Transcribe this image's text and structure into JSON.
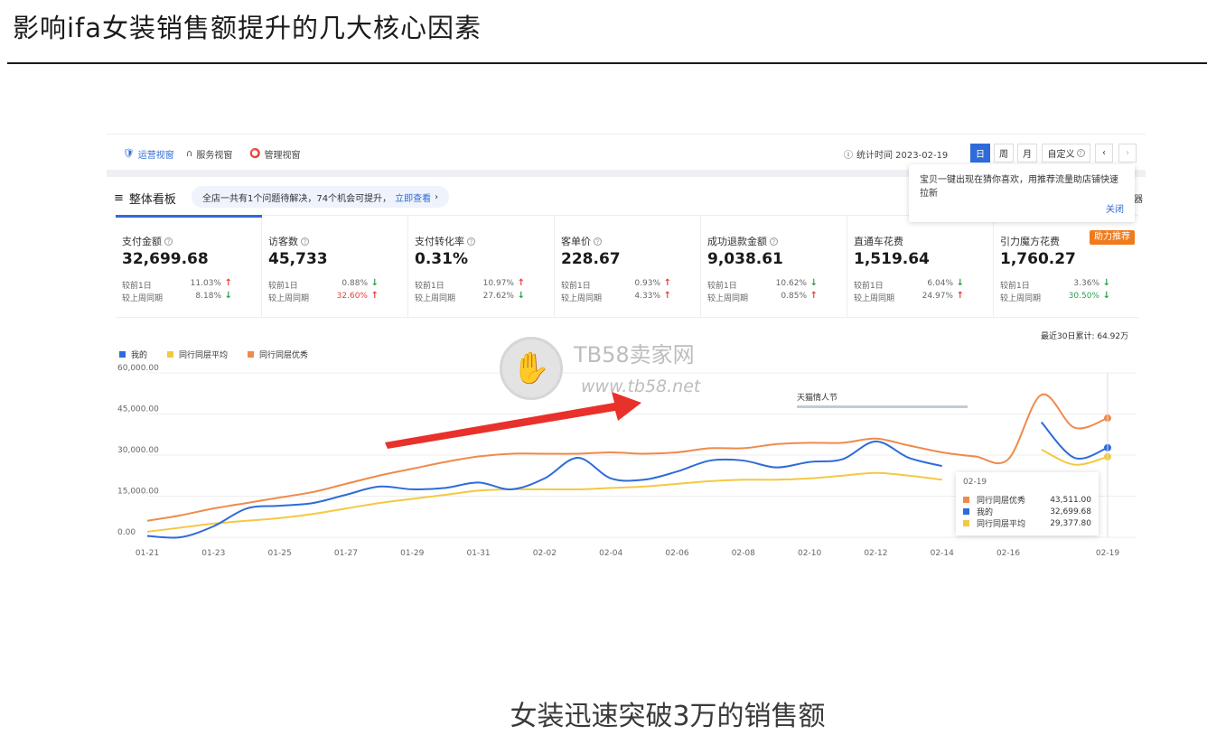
{
  "slide": {
    "title": "影响ifa女装销售额提升的几大核心因素",
    "caption": "女装迅速突破3万的销售额"
  },
  "nav": {
    "tabs": [
      {
        "label": "运营视窗",
        "icon": "shield-icon",
        "active": true
      },
      {
        "label": "服务视窗",
        "icon": "headset-icon",
        "active": false
      },
      {
        "label": "管理视窗",
        "icon": "medal-icon",
        "active": false
      }
    ],
    "stat_time": "统计时间 2023-02-19",
    "periods": [
      {
        "label": "日",
        "active": true
      },
      {
        "label": "周",
        "active": false
      },
      {
        "label": "月",
        "active": false
      },
      {
        "label": "自定义",
        "active": false
      }
    ],
    "prev_icon": "chevron-left-icon",
    "next_icon": "chevron-right-icon"
  },
  "board": {
    "title": "整体看板",
    "notice": "全店一共有1个问题待解决，74个机会可提升，",
    "notice_link": "立即查看",
    "extra": "器"
  },
  "popup": {
    "text": "宝贝一键出现在猜你喜欢，用推荐流量助店铺快速拉新",
    "close": "关闭"
  },
  "metrics": [
    {
      "label": "支付金额",
      "value": "32,699.68",
      "day_label": "较前1日",
      "day_pct": "11.03%",
      "day_dir": "up",
      "week_label": "较上周同期",
      "week_pct": "8.18%",
      "week_dir": "down"
    },
    {
      "label": "访客数",
      "value": "45,733",
      "day_label": "较前1日",
      "day_pct": "0.88%",
      "day_dir": "down",
      "week_label": "较上周同期",
      "week_pct": "32.60%",
      "week_dir": "up"
    },
    {
      "label": "支付转化率",
      "value": "0.31%",
      "day_label": "较前1日",
      "day_pct": "10.97%",
      "day_dir": "up",
      "week_label": "较上周同期",
      "week_pct": "27.62%",
      "week_dir": "down"
    },
    {
      "label": "客单价",
      "value": "228.67",
      "day_label": "较前1日",
      "day_pct": "0.93%",
      "day_dir": "up",
      "week_label": "较上周同期",
      "week_pct": "4.33%",
      "week_dir": "up"
    },
    {
      "label": "成功退款金额",
      "value": "9,038.61",
      "day_label": "较前1日",
      "day_pct": "10.62%",
      "day_dir": "down",
      "week_label": "较上周同期",
      "week_pct": "0.85%",
      "week_dir": "up"
    },
    {
      "label": "直通车花费",
      "value": "1,519.64",
      "day_label": "较前1日",
      "day_pct": "6.04%",
      "day_dir": "down",
      "week_label": "较上周同期",
      "week_pct": "24.97%",
      "week_dir": "up"
    },
    {
      "label": "引力魔方花费",
      "value": "1,760.27",
      "day_label": "较前1日",
      "day_pct": "3.36%",
      "day_dir": "down",
      "week_label": "较上周同期",
      "week_pct": "30.50%",
      "week_dir": "down",
      "badge": "助力推荐"
    }
  ],
  "cumulative": "最近30日累计: 64.92万",
  "watermark": {
    "name": "TB58卖家网",
    "url": "www.tb58.net"
  },
  "hover_tip": {
    "date": "02-19",
    "rows": [
      {
        "name": "同行同层优秀",
        "value": "43,511.00",
        "color": "#f08a4b"
      },
      {
        "name": "我的",
        "value": "32,699.68",
        "color": "#2f6bd8"
      },
      {
        "name": "同行同层平均",
        "value": "29,377.80",
        "color": "#f5c842"
      }
    ]
  },
  "colors": {
    "mine": "#2f6bd8",
    "avg": "#f5c842",
    "excellent": "#f08a4b",
    "arrow": "#e8312a",
    "accent": "#2f6bd8"
  },
  "chart_data": {
    "type": "line",
    "x": [
      "01-21",
      "01-22",
      "01-23",
      "01-24",
      "01-25",
      "01-26",
      "01-27",
      "01-28",
      "01-29",
      "01-30",
      "01-31",
      "02-01",
      "02-02",
      "02-03",
      "02-04",
      "02-05",
      "02-06",
      "02-07",
      "02-08",
      "02-09",
      "02-10",
      "02-11",
      "02-12",
      "02-13",
      "02-14",
      "02-15",
      "02-16",
      "02-17",
      "02-18",
      "02-19"
    ],
    "xticks": [
      "01-21",
      "01-23",
      "01-25",
      "01-27",
      "01-29",
      "01-31",
      "02-02",
      "02-04",
      "02-06",
      "02-08",
      "02-10",
      "02-12",
      "02-14",
      "02-16",
      "02-19"
    ],
    "yticks": [
      "60,000.00",
      "45,000.00",
      "30,000.00",
      "15,000.00",
      "0.00"
    ],
    "ylim": [
      0,
      60000
    ],
    "series": [
      {
        "name": "我的",
        "color": "#2f6bd8",
        "values": [
          500,
          0,
          4000,
          10500,
          11500,
          12500,
          15500,
          18500,
          17500,
          18000,
          20000,
          17500,
          21500,
          29000,
          21500,
          21000,
          24000,
          28000,
          28000,
          25500,
          27500,
          28500,
          35000,
          29000,
          26000,
          null,
          null,
          42000,
          29000,
          32700
        ]
      },
      {
        "name": "同行同层平均",
        "color": "#f5c842",
        "values": [
          2000,
          3500,
          5000,
          6000,
          7000,
          8500,
          10500,
          12500,
          14000,
          15500,
          17000,
          17500,
          17500,
          17500,
          18000,
          18500,
          19500,
          20500,
          21000,
          21000,
          21500,
          22500,
          23500,
          22500,
          21000,
          null,
          null,
          32000,
          26500,
          29400
        ]
      },
      {
        "name": "同行同层优秀",
        "color": "#f08a4b",
        "values": [
          6000,
          8000,
          10500,
          12500,
          14500,
          16500,
          19500,
          22500,
          25000,
          27500,
          29500,
          30500,
          30500,
          30500,
          31000,
          30500,
          31000,
          32500,
          32500,
          34000,
          34500,
          34500,
          36000,
          33500,
          31000,
          29500,
          28500,
          52000,
          40000,
          43500
        ]
      }
    ],
    "annotation": "天猫情人节"
  }
}
